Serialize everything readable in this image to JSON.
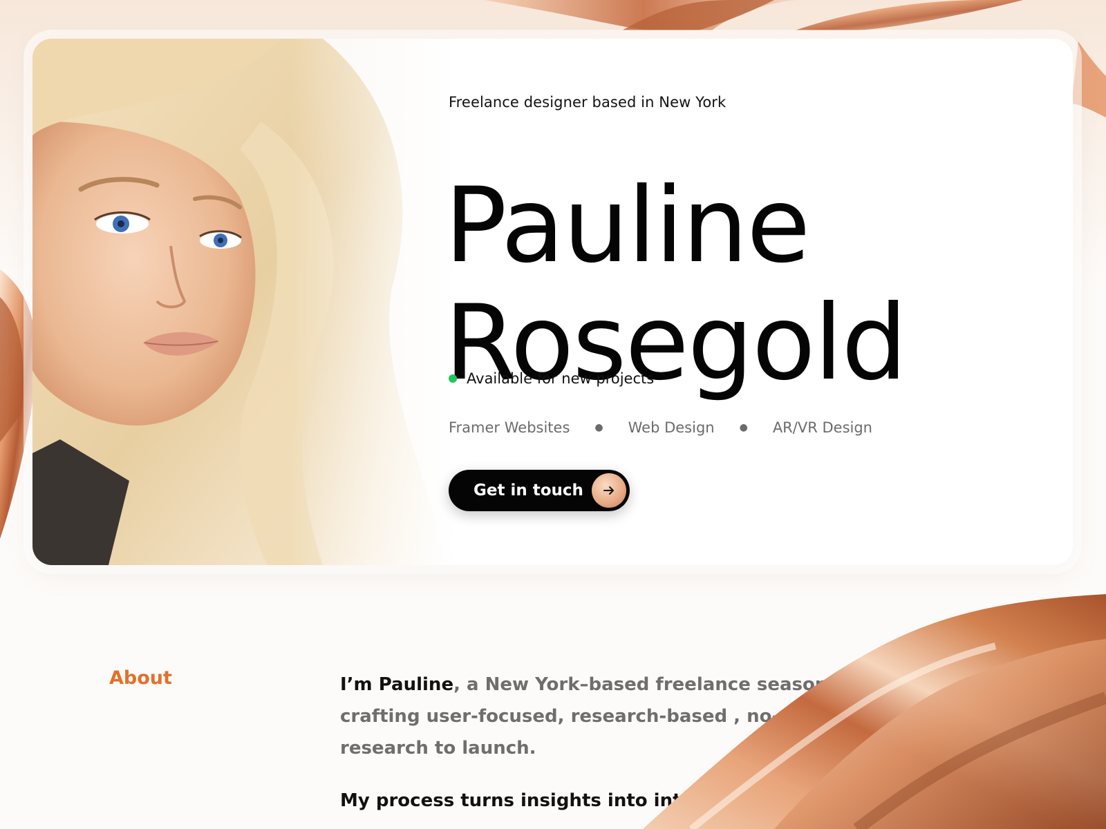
{
  "hero": {
    "tagline": "Freelance designer based in New York",
    "name_first": "Pauline",
    "name_last": "Rosegold",
    "availability": "Available for new projects",
    "services": [
      "Framer Websites",
      "Web Design",
      "AR/VR Design"
    ],
    "cta_label": "Get in touch",
    "cta_icon": "arrow-right-icon"
  },
  "about": {
    "label": "About",
    "intro_strong": "I’m Pauline",
    "intro_rest": ", a New York–based freelance seasoned U",
    "line2": "crafting user-focused, research-based , no-c",
    "line3": "research to launch.",
    "process": "My process turns insights into intu"
  },
  "colors": {
    "accent": "#e3702c",
    "status": "#22c55e",
    "cta_bg": "#050505",
    "rose_gold": "#d98b5f"
  }
}
